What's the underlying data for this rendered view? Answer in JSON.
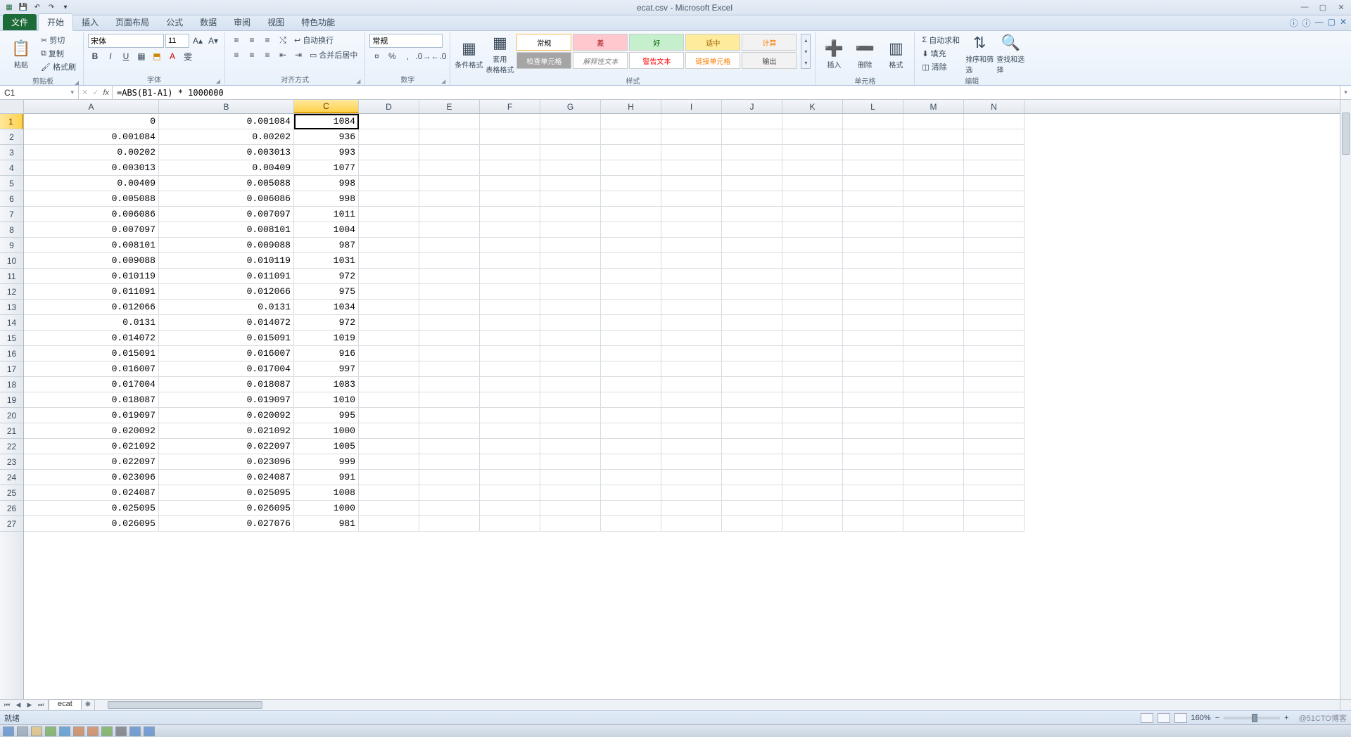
{
  "app": {
    "title": "ecat.csv - Microsoft Excel"
  },
  "tabs": {
    "file": "文件",
    "items": [
      "开始",
      "插入",
      "页面布局",
      "公式",
      "数据",
      "审阅",
      "视图",
      "特色功能"
    ],
    "active": 0
  },
  "ribbon": {
    "clipboard": {
      "paste": "粘贴",
      "cut": "剪切",
      "copy": "复制",
      "format_painter": "格式刷",
      "label": "剪贴板"
    },
    "font": {
      "name": "宋体",
      "size": "11",
      "label": "字体"
    },
    "alignment": {
      "wrap": "自动换行",
      "merge": "合并后居中",
      "label": "对齐方式"
    },
    "number": {
      "format": "常规",
      "label": "数字"
    },
    "styles": {
      "cond": "条件格式",
      "table": "套用\n表格格式",
      "gallery": [
        {
          "t": "常规",
          "bg": "#ffffff",
          "fg": "#000",
          "bd": "#f6b94d"
        },
        {
          "t": "差",
          "bg": "#ffc7ce",
          "fg": "#9c0006"
        },
        {
          "t": "好",
          "bg": "#c6efce",
          "fg": "#006100"
        },
        {
          "t": "适中",
          "bg": "#ffeb9c",
          "fg": "#9c6500"
        },
        {
          "t": "计算",
          "bg": "#f2f2f2",
          "fg": "#fa7d00"
        },
        {
          "t": "检查单元格",
          "bg": "#a5a5a5",
          "fg": "#ffffff"
        },
        {
          "t": "解释性文本",
          "bg": "#ffffff",
          "fg": "#7f7f7f",
          "it": true
        },
        {
          "t": "警告文本",
          "bg": "#ffffff",
          "fg": "#ff0000"
        },
        {
          "t": "链接单元格",
          "bg": "#ffffff",
          "fg": "#fa7d00"
        },
        {
          "t": "输出",
          "bg": "#f2f2f2",
          "fg": "#3f3f3f"
        }
      ],
      "label": "样式"
    },
    "cells": {
      "insert": "插入",
      "delete": "删除",
      "format": "格式",
      "label": "单元格"
    },
    "editing": {
      "autosum": "自动求和",
      "fill": "填充",
      "clear": "清除",
      "sort": "排序和筛选",
      "find": "查找和选择",
      "label": "编辑"
    }
  },
  "nameBox": "C1",
  "formula": "=ABS(B1-A1) * 1000000",
  "columns": [
    "A",
    "B",
    "C",
    "D",
    "E",
    "F",
    "G",
    "H",
    "I",
    "J",
    "K",
    "L",
    "M",
    "N"
  ],
  "colWidths": {
    "A": 192,
    "B": 192,
    "C": 92,
    "default": 86
  },
  "selectedCol": "C",
  "selectedRow": 1,
  "rows": [
    {
      "n": 1,
      "A": "0",
      "B": "0.001084",
      "C": "1084"
    },
    {
      "n": 2,
      "A": "0.001084",
      "B": "0.00202",
      "C": "936"
    },
    {
      "n": 3,
      "A": "0.00202",
      "B": "0.003013",
      "C": "993"
    },
    {
      "n": 4,
      "A": "0.003013",
      "B": "0.00409",
      "C": "1077"
    },
    {
      "n": 5,
      "A": "0.00409",
      "B": "0.005088",
      "C": "998"
    },
    {
      "n": 6,
      "A": "0.005088",
      "B": "0.006086",
      "C": "998"
    },
    {
      "n": 7,
      "A": "0.006086",
      "B": "0.007097",
      "C": "1011"
    },
    {
      "n": 8,
      "A": "0.007097",
      "B": "0.008101",
      "C": "1004"
    },
    {
      "n": 9,
      "A": "0.008101",
      "B": "0.009088",
      "C": "987"
    },
    {
      "n": 10,
      "A": "0.009088",
      "B": "0.010119",
      "C": "1031"
    },
    {
      "n": 11,
      "A": "0.010119",
      "B": "0.011091",
      "C": "972"
    },
    {
      "n": 12,
      "A": "0.011091",
      "B": "0.012066",
      "C": "975"
    },
    {
      "n": 13,
      "A": "0.012066",
      "B": "0.0131",
      "C": "1034"
    },
    {
      "n": 14,
      "A": "0.0131",
      "B": "0.014072",
      "C": "972"
    },
    {
      "n": 15,
      "A": "0.014072",
      "B": "0.015091",
      "C": "1019"
    },
    {
      "n": 16,
      "A": "0.015091",
      "B": "0.016007",
      "C": "916"
    },
    {
      "n": 17,
      "A": "0.016007",
      "B": "0.017004",
      "C": "997"
    },
    {
      "n": 18,
      "A": "0.017004",
      "B": "0.018087",
      "C": "1083"
    },
    {
      "n": 19,
      "A": "0.018087",
      "B": "0.019097",
      "C": "1010"
    },
    {
      "n": 20,
      "A": "0.019097",
      "B": "0.020092",
      "C": "995"
    },
    {
      "n": 21,
      "A": "0.020092",
      "B": "0.021092",
      "C": "1000"
    },
    {
      "n": 22,
      "A": "0.021092",
      "B": "0.022097",
      "C": "1005"
    },
    {
      "n": 23,
      "A": "0.022097",
      "B": "0.023096",
      "C": "999"
    },
    {
      "n": 24,
      "A": "0.023096",
      "B": "0.024087",
      "C": "991"
    },
    {
      "n": 25,
      "A": "0.024087",
      "B": "0.025095",
      "C": "1008"
    },
    {
      "n": 26,
      "A": "0.025095",
      "B": "0.026095",
      "C": "1000"
    },
    {
      "n": 27,
      "A": "0.026095",
      "B": "0.027076",
      "C": "981"
    }
  ],
  "sheet": {
    "name": "ecat"
  },
  "status": {
    "ready": "就绪",
    "zoom": "160%",
    "credit": "@51CTO博客"
  }
}
